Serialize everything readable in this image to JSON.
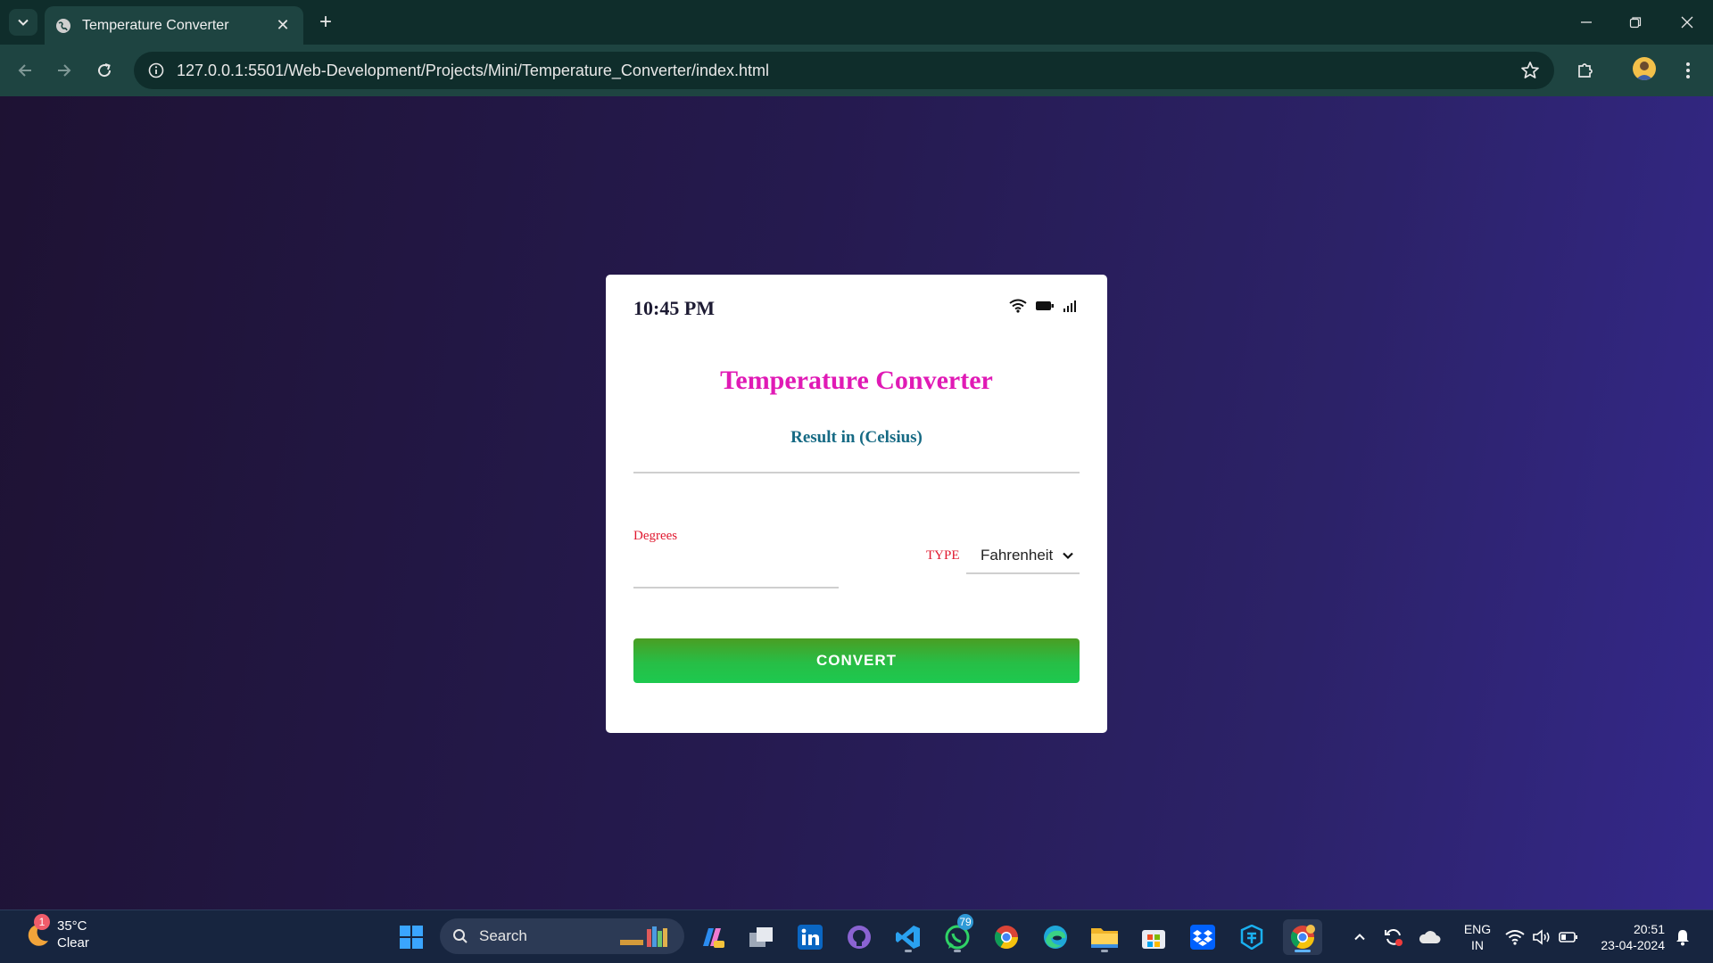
{
  "browser": {
    "tab_title": "Temperature Converter",
    "url": "127.0.0.1:5501/Web-Development/Projects/Mini/Temperature_Converter/index.html"
  },
  "app": {
    "status_time": "10:45 PM",
    "title": "Temperature Converter",
    "result_label": "Result in (Celsius)",
    "degrees_label": "Degrees",
    "degrees_value": "",
    "type_label": "TYPE",
    "type_selected": "Fahrenheit",
    "convert_label": "CONVERT",
    "colors": {
      "title": "#e01ab5",
      "result": "#166a84",
      "labels": "#e0182f",
      "button": "#27be46"
    }
  },
  "taskbar": {
    "weather_temp": "35°C",
    "weather_desc": "Clear",
    "weather_badge": "1",
    "search_label": "Search",
    "whatsapp_badge": "79",
    "lang_top": "ENG",
    "lang_bottom": "IN",
    "time": "20:51",
    "date": "23-04-2024",
    "icons": [
      "windows-start-icon",
      "search-icon",
      "copilot-icon",
      "task-view-icon",
      "linkedin-icon",
      "github-icon",
      "vscode-icon",
      "whatsapp-icon",
      "chrome-icon",
      "edge-icon",
      "file-explorer-icon",
      "store-icon",
      "dropbox-icon",
      "app-icon",
      "chrome-profile-icon"
    ]
  }
}
